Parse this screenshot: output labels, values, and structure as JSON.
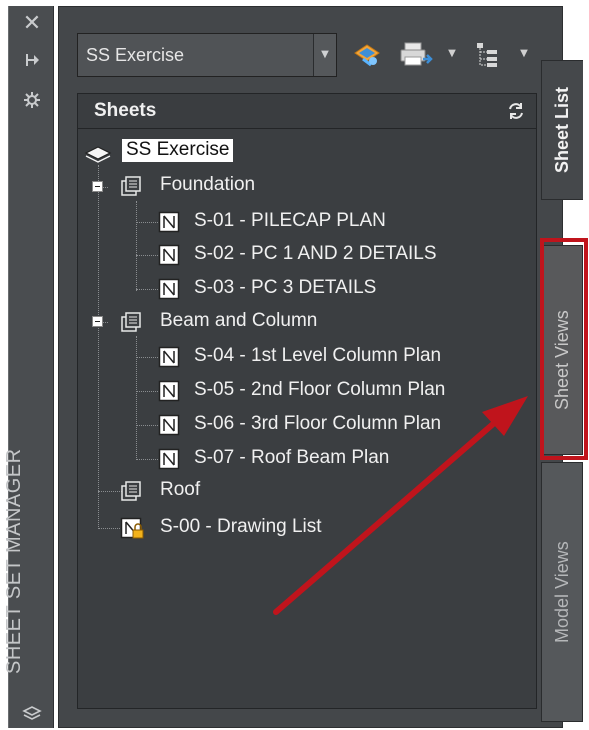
{
  "panel": {
    "title": "SHEET SET MANAGER"
  },
  "toolbar": {
    "sheet_set_selector": {
      "value": "SS Exercise"
    }
  },
  "sheets_section": {
    "title": "Sheets"
  },
  "tree": {
    "root": "SS Exercise",
    "foundation": {
      "label": "Foundation",
      "sheets": [
        "S-01 - PILECAP PLAN",
        "S-02 - PC 1 AND 2 DETAILS",
        "S-03 - PC 3 DETAILS"
      ]
    },
    "beam_column": {
      "label": "Beam and Column",
      "sheets": [
        "S-04 - 1st Level Column Plan",
        "S-05 - 2nd Floor Column Plan",
        "S-06 - 3rd Floor Column Plan",
        "S-07 - Roof Beam Plan"
      ]
    },
    "roof": {
      "label": "Roof"
    },
    "drawing_list": {
      "label": "S-00 - Drawing List"
    }
  },
  "tabs": [
    {
      "label": "Sheet List",
      "active": true
    },
    {
      "label": "Sheet Views",
      "active": false
    },
    {
      "label": "Model Views",
      "active": false
    }
  ],
  "annotation": {
    "highlight_color": "#c0141c",
    "arrow_color": "#c0141c"
  }
}
